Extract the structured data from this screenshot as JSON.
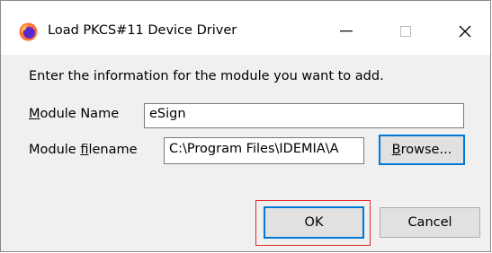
{
  "window": {
    "title": "Load PKCS#11 Device Driver",
    "icon": "firefox-icon",
    "controls": [
      "minimize-icon",
      "maximize-icon",
      "close-icon"
    ]
  },
  "form": {
    "intro_text": "Enter the information for the module you want to add.",
    "module_name": {
      "label_accel": "M",
      "label_rest": "odule Name",
      "value": "eSign"
    },
    "module_filename": {
      "label_pre": "Module ",
      "label_accel": "f",
      "label_rest": "ilename",
      "value": "C:\\Program Files\\IDEMIA\\A"
    },
    "browse": {
      "accel": "B",
      "rest": "rowse..."
    }
  },
  "buttons": {
    "ok_label": "OK",
    "cancel_label": "Cancel"
  },
  "colors": {
    "focus_border": "#0078d7",
    "highlight_box": "#e02b2b",
    "dialog_bg": "#f0f0f0"
  }
}
